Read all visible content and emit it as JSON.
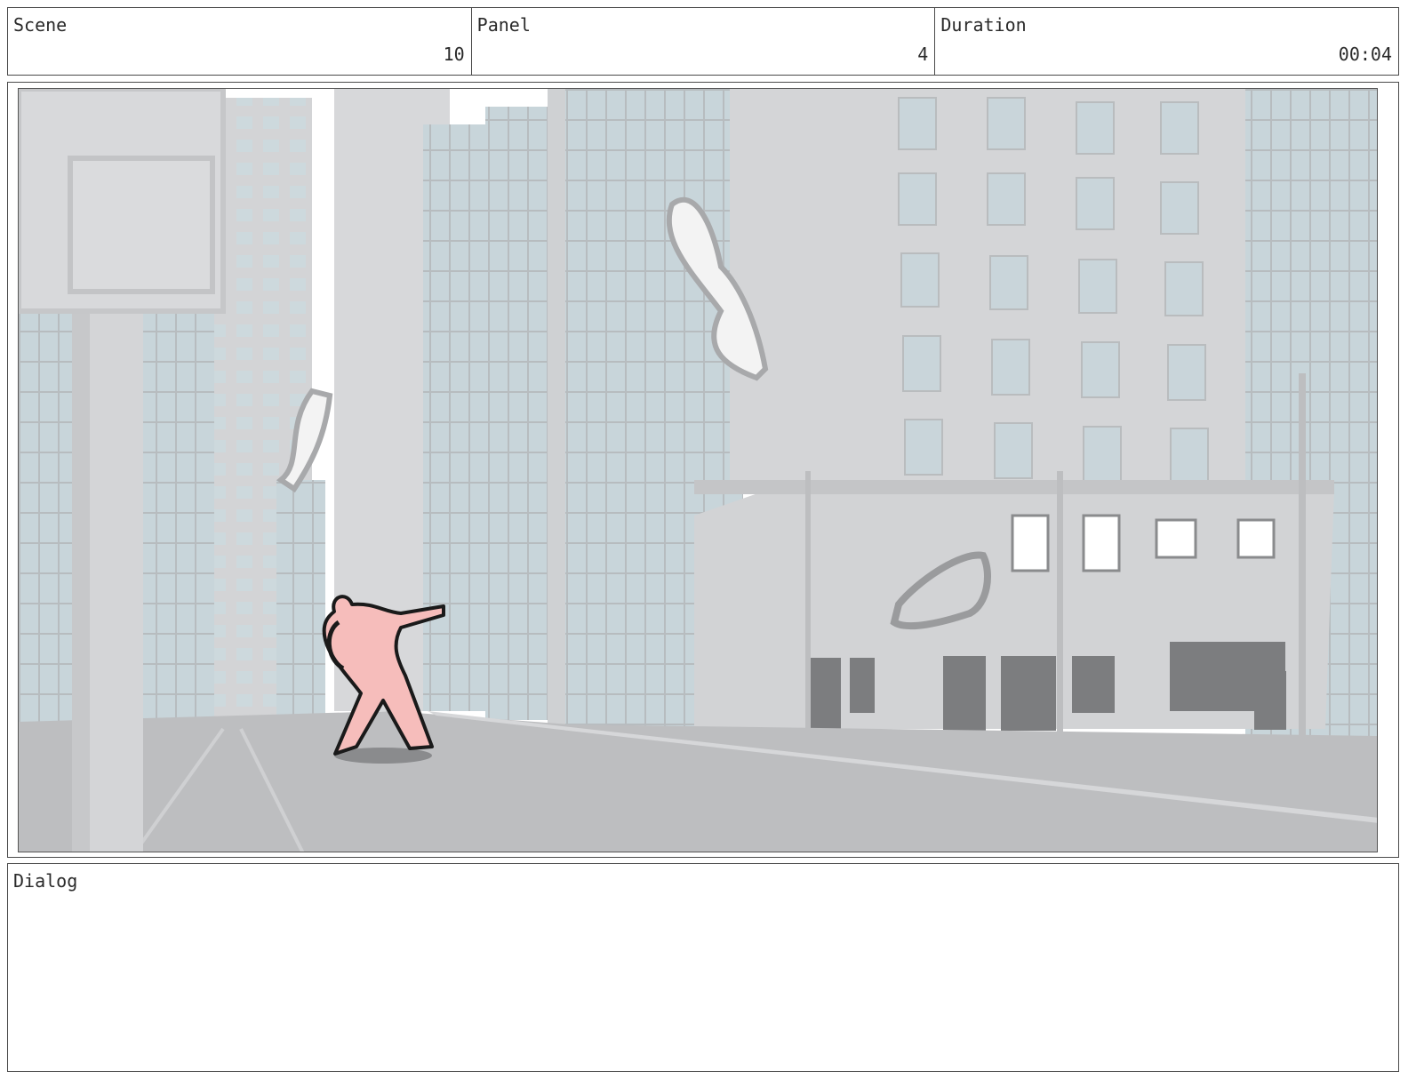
{
  "header": {
    "scene": {
      "label": "Scene",
      "value": "10"
    },
    "panel": {
      "label": "Panel",
      "value": "4"
    },
    "duration": {
      "label": "Duration",
      "value": "00:04"
    }
  },
  "frame": {
    "icons": [
      "city-street-illustration",
      "figure-sketch"
    ],
    "colors": {
      "sky": "#ffffff",
      "building": "#d6d7d9",
      "glass": "#c9d6db",
      "road": "#bcbdbf",
      "figure": "#f6bdbb"
    }
  },
  "dialog": {
    "label": "Dialog",
    "text": ""
  }
}
